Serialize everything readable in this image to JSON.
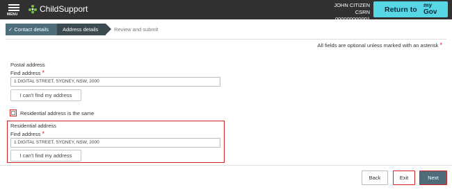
{
  "header": {
    "menu_label": "MENU",
    "brand": "ChildSupport",
    "user_name": "JOHN CITIZEN",
    "csrn": "CSRN 000000000001",
    "return_label": "Return to",
    "return_my": "my",
    "return_gov": "Gov",
    "return_color": "#57d7e6"
  },
  "steps": [
    {
      "label": "Contact details",
      "status": "complete"
    },
    {
      "label": "Address details",
      "status": "current"
    },
    {
      "label": "Review and submit",
      "status": "upcoming"
    }
  ],
  "form": {
    "required_note": "All fields are optional unless marked with an asterisk",
    "asterisk": "*",
    "postal": {
      "section_title": "Postal address",
      "find_label": "Find address",
      "value": "1 DIGITAL STREET, SYDNEY, NSW, 2000",
      "cant_find_label": "I can't find my address"
    },
    "same_checkbox": {
      "label": "Residential address is the same",
      "checked": false
    },
    "residential": {
      "section_title": "Residential address",
      "find_label": "Find address",
      "value": "1 DIGITAL STREET, SYDNEY, NSW, 2000",
      "cant_find_label": "I can't find my address"
    }
  },
  "footer": {
    "back_label": "Back",
    "exit_label": "Exit",
    "next_label": "Next"
  },
  "colors": {
    "topbar": "#313131",
    "accent_red": "#d32020",
    "step_complete": "#4d6d7a",
    "step_current": "#3c4a52",
    "primary_button": "#4e6c79"
  }
}
